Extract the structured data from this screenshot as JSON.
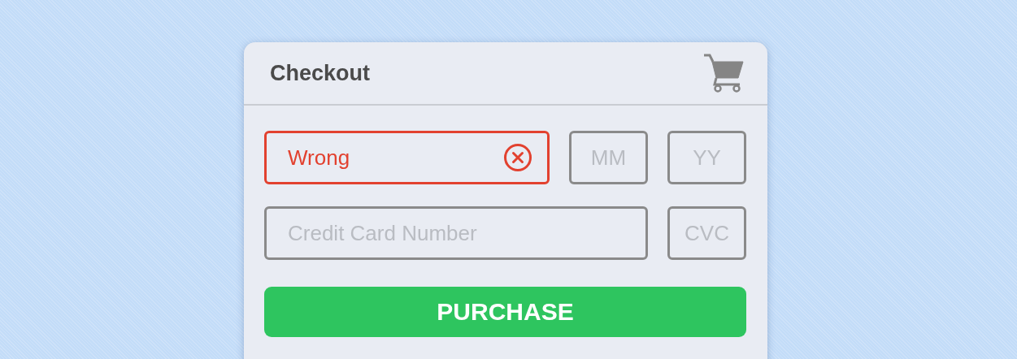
{
  "checkout": {
    "title": "Checkout"
  },
  "field_rows": [
    [
      {
        "value": "Wrong",
        "error": true
      },
      {
        "placeholder": "MM",
        "error": false
      },
      {
        "placeholder": "YY",
        "error": false
      }
    ],
    [
      {
        "placeholder": "Credit Card Number",
        "error": false
      },
      {
        "placeholder": "CVC",
        "error": false
      }
    ]
  ],
  "purchase_button": {
    "label": "PURCHASE"
  }
}
